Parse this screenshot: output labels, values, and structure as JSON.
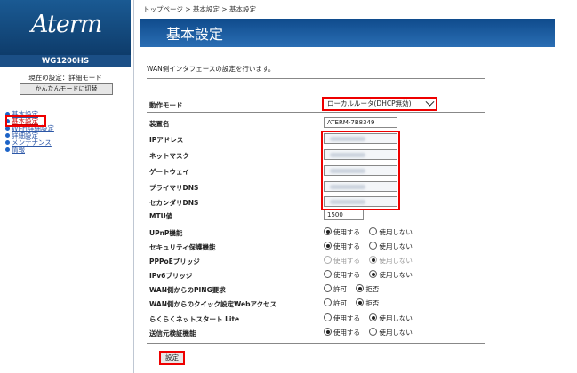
{
  "sidebar": {
    "logo": "Aterm",
    "model": "WG1200HS",
    "current_mode": "現在の設定：詳細モード",
    "simple_mode_button": "かんたんモードに切替",
    "nav": [
      {
        "label": "基本設定",
        "active": false
      },
      {
        "label": "基本設定",
        "active": true
      },
      {
        "label": "Wi-Fi詳細設定",
        "active": false
      },
      {
        "label": "詳細設定",
        "active": false
      },
      {
        "label": "メンテナンス",
        "active": false
      },
      {
        "label": "情報",
        "active": false
      }
    ]
  },
  "breadcrumb": "トップページ > 基本設定 > 基本設定",
  "page": {
    "title": "基本設定",
    "description": "WAN側インタフェースの設定を行います。"
  },
  "form": {
    "mode": {
      "label": "動作モード",
      "value": "ローカルルータ(DHCP無効)"
    },
    "device_name": {
      "label": "装置名",
      "value": "ATERM-7B8349"
    },
    "ip_address": {
      "label": "IPアドレス"
    },
    "netmask": {
      "label": "ネットマスク"
    },
    "gateway": {
      "label": "ゲートウェイ"
    },
    "primary_dns": {
      "label": "プライマリDNS"
    },
    "secondary_dns": {
      "label": "セカンダリDNS"
    },
    "mtu": {
      "label": "MTU値",
      "value": "1500"
    },
    "upnp": {
      "label": "UPnP機能",
      "opt1": "使用する",
      "opt2": "使用しない"
    },
    "security": {
      "label": "セキュリティ保護機能",
      "opt1": "使用する",
      "opt2": "使用しない"
    },
    "pppoe_bridge": {
      "label": "PPPoEブリッジ",
      "opt1": "使用する",
      "opt2": "使用しない"
    },
    "ipv6_bridge": {
      "label": "IPv6ブリッジ",
      "opt1": "使用する",
      "opt2": "使用しない"
    },
    "wan_ping": {
      "label": "WAN側からのPING要求",
      "opt1": "許可",
      "opt2": "拒否"
    },
    "wan_quick_web": {
      "label": "WAN側からのクイック設定Webアクセス",
      "opt1": "許可",
      "opt2": "拒否"
    },
    "rakuraku_net": {
      "label": "らくらくネットスタート Lite",
      "opt1": "使用する",
      "opt2": "使用しない"
    },
    "source_verify": {
      "label": "送信元検証機能",
      "opt1": "使用する",
      "opt2": "使用しない"
    },
    "submit": "設定"
  },
  "colors": {
    "title_bar": "#1a5c9e",
    "highlight": "#e00000",
    "link": "#2c57a7"
  }
}
